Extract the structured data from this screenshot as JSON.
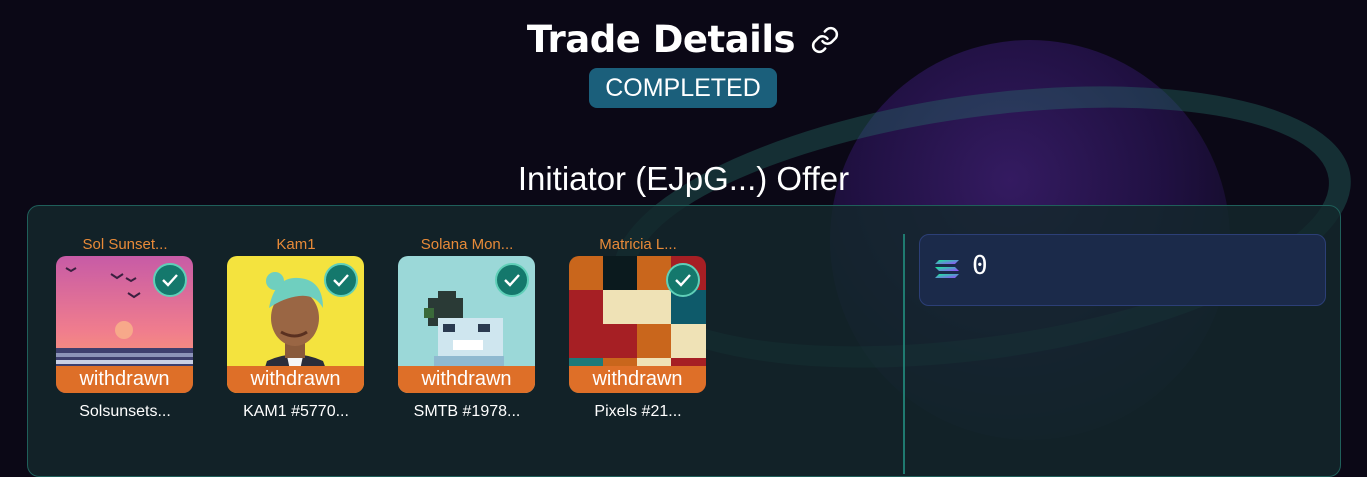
{
  "header": {
    "title": "Trade Details",
    "link_icon": "link-icon",
    "status": "COMPLETED"
  },
  "section": {
    "title": "Initiator (EJpG...) Offer"
  },
  "nfts": [
    {
      "collection": "Sol Sunset...",
      "label": "Solsunsets...",
      "status": "withdrawn",
      "icon": "check-icon"
    },
    {
      "collection": "Kam1",
      "label": "KAM1 #5770...",
      "status": "withdrawn",
      "icon": "check-icon"
    },
    {
      "collection": "Solana Mon...",
      "label": "SMTB #1978...",
      "status": "withdrawn",
      "icon": "check-icon"
    },
    {
      "collection": "Matricia L...",
      "label": "Pixels #21...",
      "status": "withdrawn",
      "icon": "check-icon"
    }
  ],
  "sol": {
    "icon": "solana-icon",
    "amount": "0"
  },
  "colors": {
    "background": "#0b0816",
    "panel": "#14282c",
    "status_badge": "#1b5f7b",
    "withdrawn": "#de6f28",
    "collection_name": "#e88a38",
    "check": "#14786c"
  }
}
